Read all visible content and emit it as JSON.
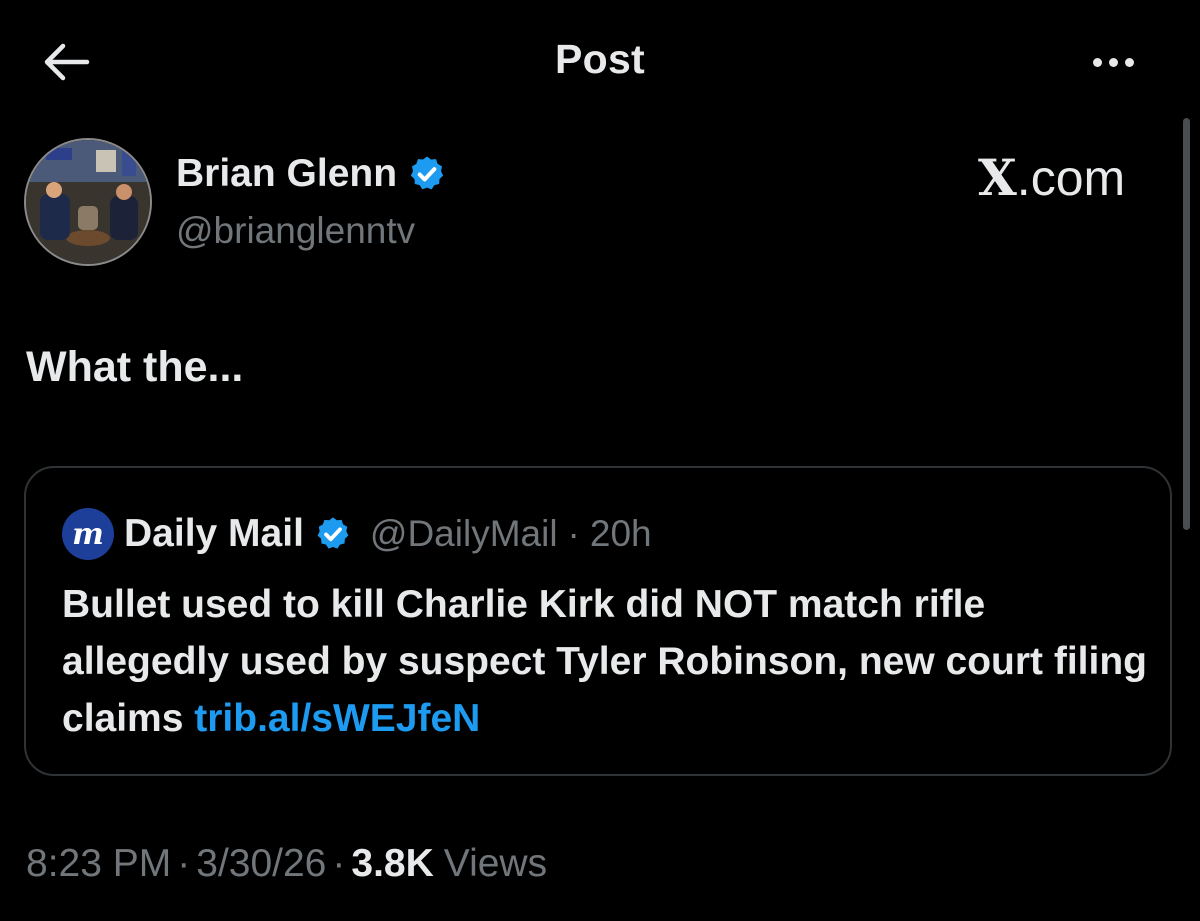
{
  "header": {
    "title": "Post",
    "back_icon": "arrow-left-icon",
    "more_icon": "more-horizontal-icon"
  },
  "author": {
    "name": "Brian Glenn",
    "handle": "@brianglenntv",
    "verified": true,
    "avatar_icon": "avatar"
  },
  "watermark": {
    "mark": "X",
    "domain": ".com"
  },
  "post": {
    "text": "What the..."
  },
  "quote": {
    "source_name": "Daily Mail",
    "logo_letter": "m",
    "verified": true,
    "handle": "@DailyMail",
    "separator": "·",
    "time": "20h",
    "text": "Bullet used to kill Charlie Kirk did NOT match rifle allegedly used by suspect Tyler Robinson, new court filing claims ",
    "link": "trib.al/sWEJfeN"
  },
  "meta": {
    "time": "8:23 PM",
    "sep1": "·",
    "date": "3/30/26",
    "sep2": "·",
    "views_count": "3.8K",
    "views_label": "Views"
  },
  "colors": {
    "background": "#000000",
    "text_primary": "#e7e9ea",
    "text_secondary": "#71767b",
    "link": "#1d9bf0",
    "verified_badge": "#1d9bf0",
    "card_border": "#2f3336",
    "daily_mail_logo": "#1d3f9a"
  }
}
